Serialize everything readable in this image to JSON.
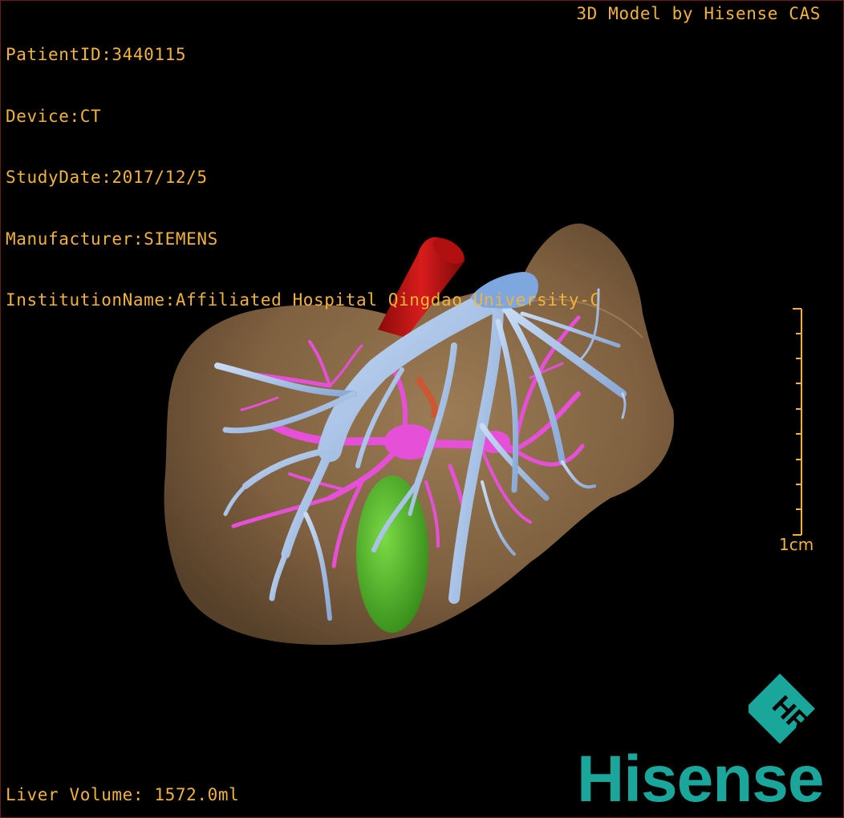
{
  "overlay": {
    "patient_id": "PatientID:3440115",
    "device": "Device:CT",
    "study_date": "StudyDate:2017/12/5",
    "manufacturer": "Manufacturer:SIEMENS",
    "institution": "InstitutionName:Affiliated Hospital Qingdao University-C",
    "model_credit": "3D Model by Hisense CAS",
    "liver_volume": "Liver Volume: 1572.0ml"
  },
  "scale_bar": {
    "label": "1cm"
  },
  "logo": {
    "badge_text": "HR",
    "brand": "Hisense"
  },
  "colors": {
    "text": "#f2b33a",
    "liver": "#8a6a45",
    "portal_vein": "#a9c3e6",
    "hepatic_vessels": "#e650d8",
    "artery": "#c41414",
    "gallbladder": "#4fc02e",
    "brand": "#1aa69a"
  },
  "icons": [
    "hisense-hr-badge-icon"
  ]
}
